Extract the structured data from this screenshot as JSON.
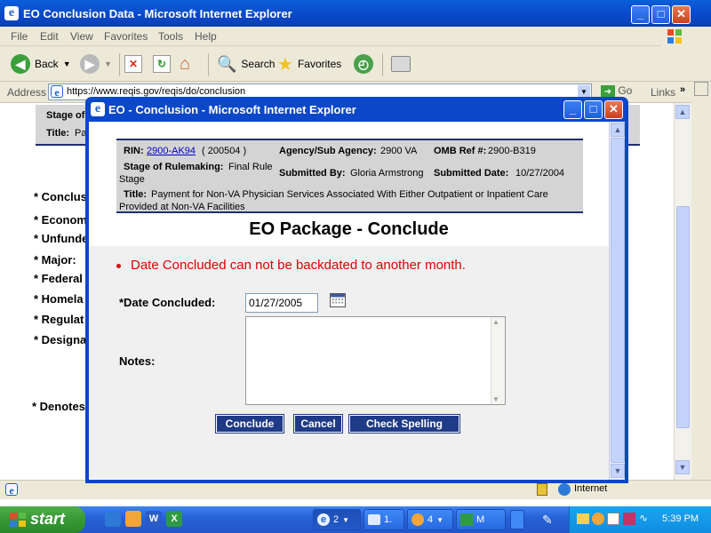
{
  "outer_window": {
    "title": "EO Conclusion Data - Microsoft Internet Explorer",
    "buttons": {
      "minimize": "_",
      "maximize": "□",
      "close": "✕"
    }
  },
  "menu": [
    "File",
    "Edit",
    "View",
    "Favorites",
    "Tools",
    "Help"
  ],
  "toolbar": {
    "back": "Back",
    "search": "Search",
    "favorites": "Favorites"
  },
  "address": {
    "label": "Address",
    "url": "https://www.reqis.gov/reqis/do/conclusion",
    "go": "Go",
    "links": "Links"
  },
  "background_page": {
    "stage_label": "Stage of",
    "title_label": "Title:",
    "title_frag": "Pa",
    "fields": [
      "* Conclus",
      "* Econom",
      "* Unfunde",
      "* Major:",
      "* Federal",
      "* Homela",
      "* Regulat",
      "* Designa"
    ],
    "denotes": "* Denotes"
  },
  "statusbar": {
    "zone": "Internet"
  },
  "dialog": {
    "title": "EO - Conclusion - Microsoft Internet Explorer",
    "info": {
      "rin_label": "RIN:",
      "rin_value": "2900-AK94",
      "rin_code": "(  200504  )",
      "agency_label": "Agency/Sub Agency:",
      "agency_value": "2900 VA",
      "omb_label": "OMB Ref #:",
      "omb_value": "2900-B319",
      "stage_label": "Stage of Rulemaking:",
      "stage_value_1": "Final Rule",
      "stage_value_2": "Stage",
      "submitted_by_label": "Submitted By:",
      "submitted_by_value": "Gloria Armstrong",
      "submitted_date_label": "Submitted Date:",
      "submitted_date_value": "10/27/2004",
      "title_label": "Title:",
      "title_value_1": "Payment for Non-VA Physician Services Associated With Either Outpatient or Inpatient Care",
      "title_value_2": "Provided at Non-VA Facilities"
    },
    "heading": "EO Package - Conclude",
    "error": "Date Concluded can not be backdated to another month.",
    "date_label": "*Date Concluded:",
    "date_value": "01/27/2005",
    "notes_label": "Notes:",
    "buttons": {
      "conclude": "Conclude",
      "cancel": "Cancel",
      "check_spelling": "Check Spelling"
    }
  },
  "taskbar": {
    "start": "start",
    "tasks": [
      {
        "count": "2",
        "label": ""
      },
      {
        "count": "",
        "label": "1."
      },
      {
        "count": "4",
        "label": ""
      },
      {
        "count": "",
        "label": "M"
      }
    ],
    "clock": "5:39 PM"
  },
  "colors": {
    "title_blue": "#0a47c9",
    "error_red": "#e00000",
    "button_navy": "#1f3a86",
    "start_green": "#379936"
  }
}
